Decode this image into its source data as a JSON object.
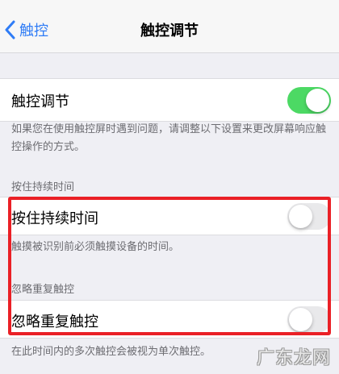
{
  "nav": {
    "back_label": "触控",
    "title": "触控调节"
  },
  "main_setting": {
    "label": "触控调节",
    "enabled": true,
    "footer": "如果您在使用触控屏时遇到问题，请调整以下设置来更改屏幕响应触控操作的方式。"
  },
  "hold_duration": {
    "section_header": "按住持续时间",
    "label": "按住持续时间",
    "enabled": false,
    "footer": "触摸被识别前必须触摸设备的时间。"
  },
  "ignore_repeat": {
    "section_header": "忽略重复触控",
    "label": "忽略重复触控",
    "enabled": false,
    "footer": "在此时间内的多次触控会被视为单次触控。"
  },
  "watermark": "广东龙网",
  "colors": {
    "accent": "#2f7cf6",
    "toggle_on": "#4cd964",
    "highlight": "#ea2026"
  },
  "icons": {
    "back": "chevron-left-icon"
  }
}
